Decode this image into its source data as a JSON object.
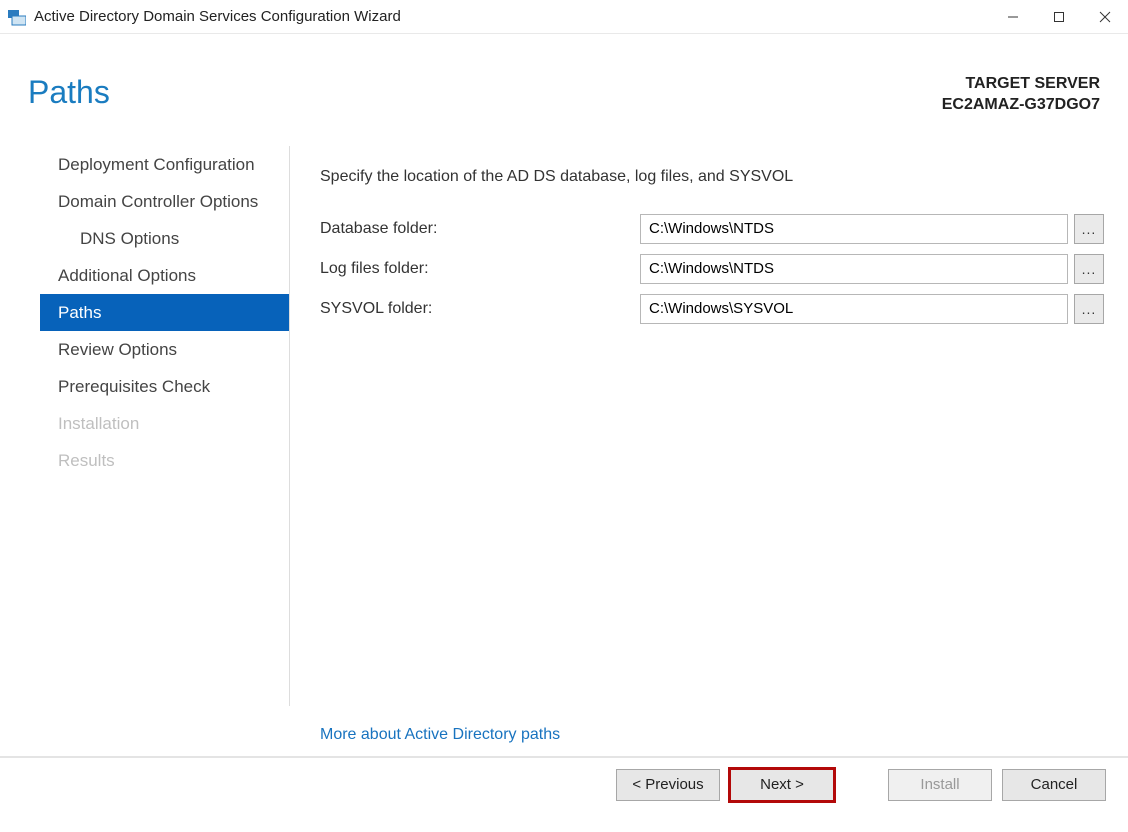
{
  "window": {
    "title": "Active Directory Domain Services Configuration Wizard"
  },
  "header": {
    "page_title": "Paths",
    "target_label": "TARGET SERVER",
    "target_server": "EC2AMAZ-G37DGO7"
  },
  "sidebar": {
    "items": [
      {
        "label": "Deployment Configuration",
        "sub": false,
        "selected": false,
        "disabled": false
      },
      {
        "label": "Domain Controller Options",
        "sub": false,
        "selected": false,
        "disabled": false
      },
      {
        "label": "DNS Options",
        "sub": true,
        "selected": false,
        "disabled": false
      },
      {
        "label": "Additional Options",
        "sub": false,
        "selected": false,
        "disabled": false
      },
      {
        "label": "Paths",
        "sub": false,
        "selected": true,
        "disabled": false
      },
      {
        "label": "Review Options",
        "sub": false,
        "selected": false,
        "disabled": false
      },
      {
        "label": "Prerequisites Check",
        "sub": false,
        "selected": false,
        "disabled": false
      },
      {
        "label": "Installation",
        "sub": false,
        "selected": false,
        "disabled": true
      },
      {
        "label": "Results",
        "sub": false,
        "selected": false,
        "disabled": true
      }
    ]
  },
  "main": {
    "instruction": "Specify the location of the AD DS database, log files, and SYSVOL",
    "fields": [
      {
        "label": "Database folder:",
        "value": "C:\\Windows\\NTDS"
      },
      {
        "label": "Log files folder:",
        "value": "C:\\Windows\\NTDS"
      },
      {
        "label": "SYSVOL folder:",
        "value": "C:\\Windows\\SYSVOL"
      }
    ],
    "browse_label": "...",
    "more_link": "More about Active Directory paths"
  },
  "footer": {
    "previous": "< Previous",
    "next": "Next >",
    "install": "Install",
    "cancel": "Cancel"
  }
}
